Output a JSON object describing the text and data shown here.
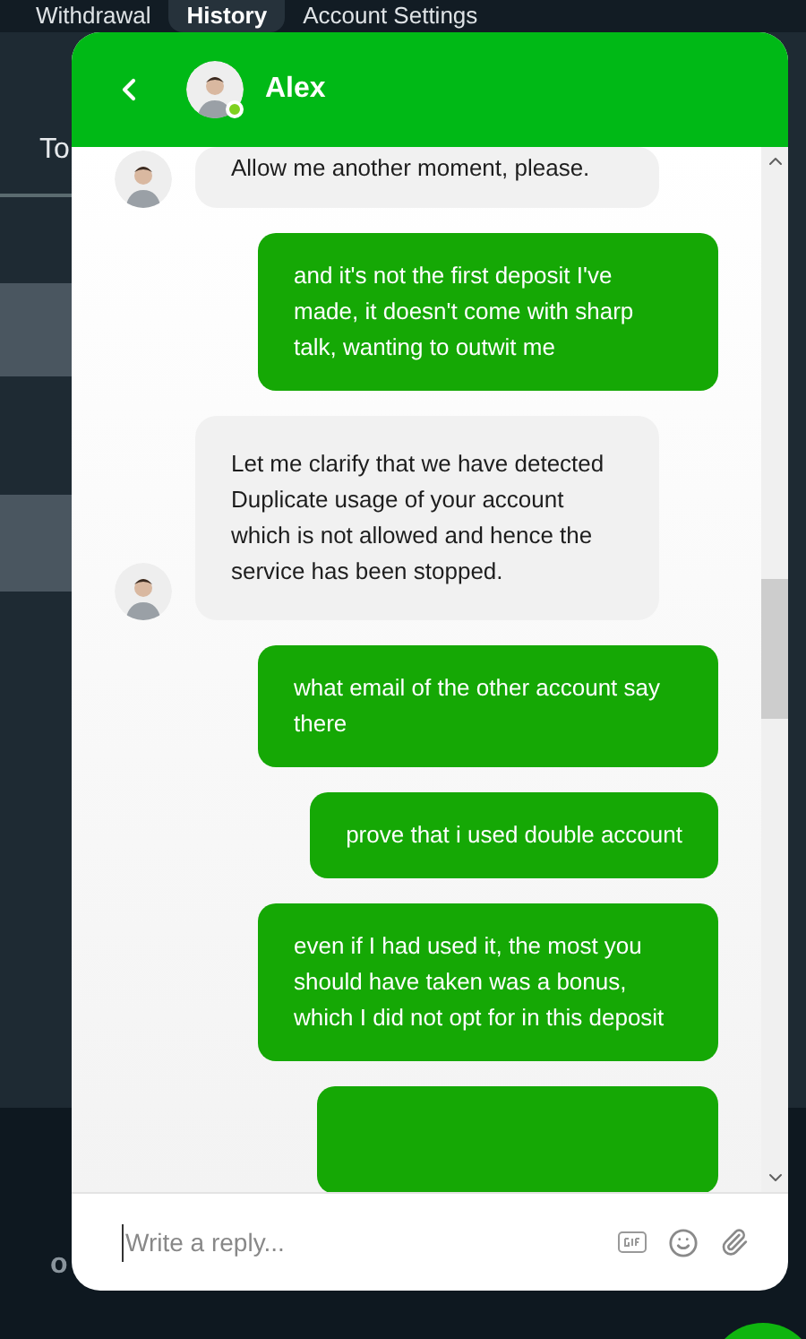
{
  "page_tabs": [
    {
      "label": "Withdrawal",
      "selected": false
    },
    {
      "label": "History",
      "selected": true
    },
    {
      "label": "Account Settings",
      "selected": false
    }
  ],
  "page_fragments": {
    "top": "To",
    "bottom": "o"
  },
  "chat": {
    "agent": {
      "name": "Alex",
      "online": true
    },
    "messages": [
      {
        "kind": "agent",
        "text": "Allow me another moment, please."
      },
      {
        "kind": "user",
        "text": "and it's not the first deposit I've made, it doesn't come with sharp talk, wanting to outwit me"
      },
      {
        "kind": "agent",
        "text": "Let me clarify that we have detected Duplicate usage of your account which is not allowed and hence the service has been stopped."
      },
      {
        "kind": "user",
        "text": "what email of the other account say there"
      },
      {
        "kind": "user",
        "text": "prove that i used double account"
      },
      {
        "kind": "user",
        "text": "even if I had used it, the most you should have taken was a bonus, which I did not opt for in this deposit"
      },
      {
        "kind": "user"
      }
    ],
    "reply": {
      "placeholder": "Write a reply..."
    }
  }
}
